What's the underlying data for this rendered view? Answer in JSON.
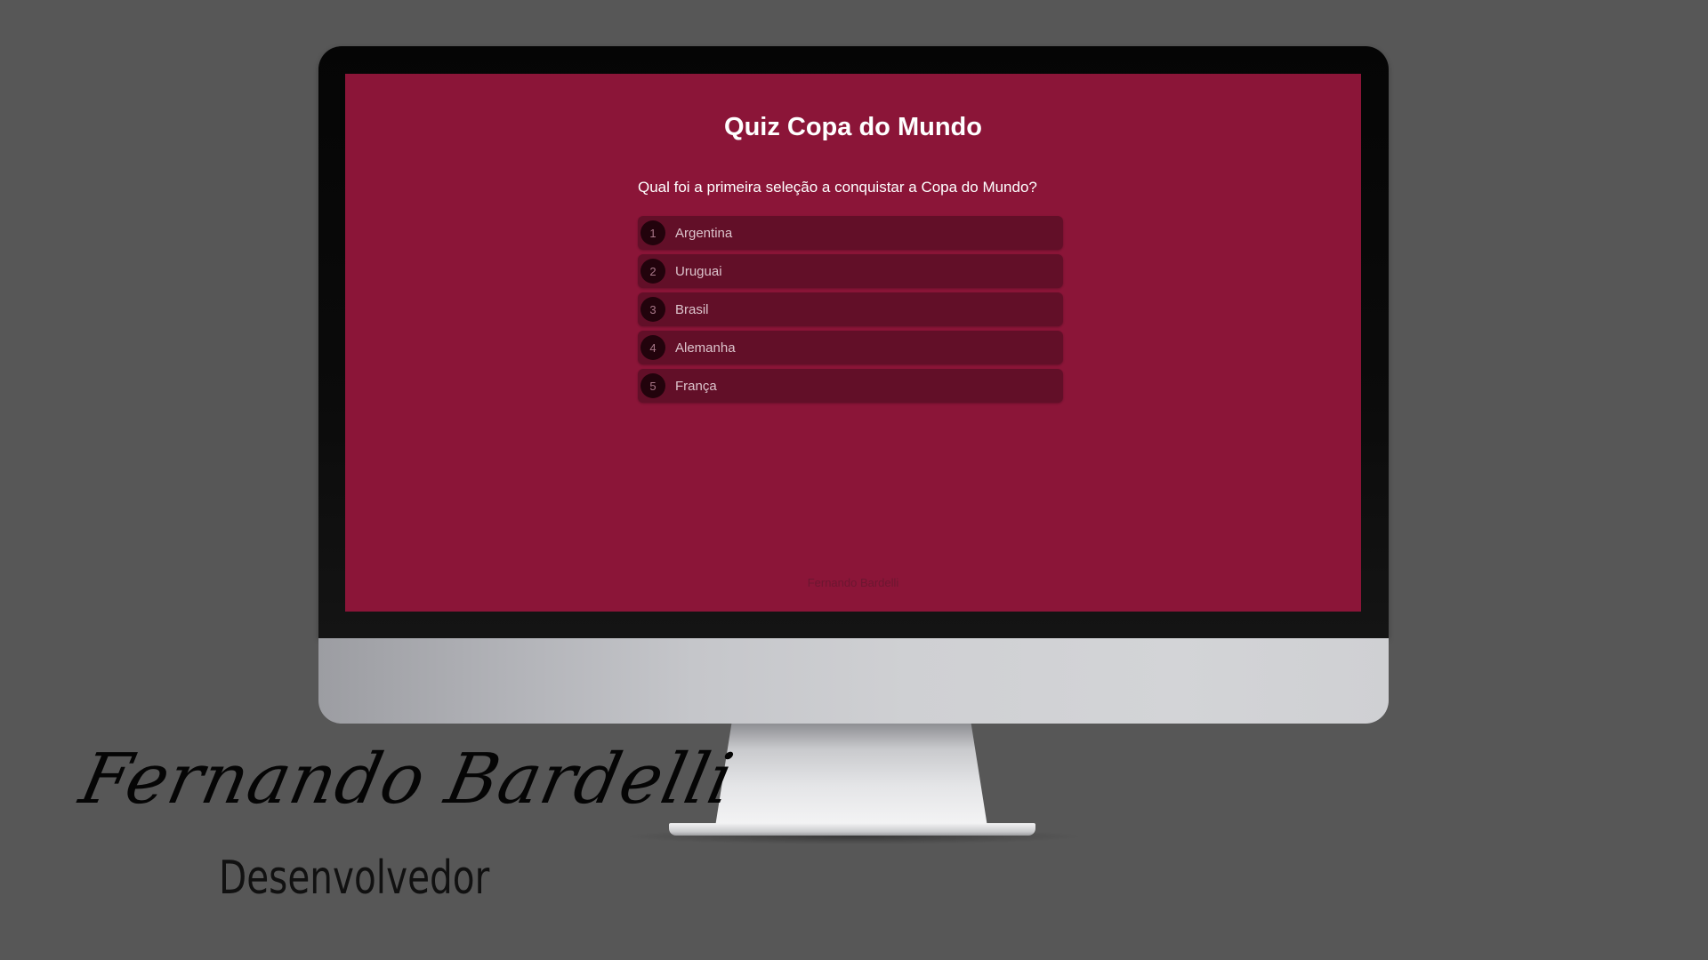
{
  "quiz": {
    "title": "Quiz Copa do Mundo",
    "question": "Qual foi a primeira seleção a conquistar a Copa do Mundo?",
    "answers": [
      {
        "number": "1",
        "label": "Argentina"
      },
      {
        "number": "2",
        "label": "Uruguai"
      },
      {
        "number": "3",
        "label": "Brasil"
      },
      {
        "number": "4",
        "label": "Alemanha"
      },
      {
        "number": "5",
        "label": "França"
      }
    ],
    "footer": "Fernando Bardelli"
  },
  "overlay": {
    "signature": "Fernando Bardelli",
    "role": "Desenvolvedor"
  },
  "colors": {
    "background": "#575757",
    "screen": "#8b1538",
    "answer_bg": "#620f28",
    "number_bg": "#22030c"
  }
}
